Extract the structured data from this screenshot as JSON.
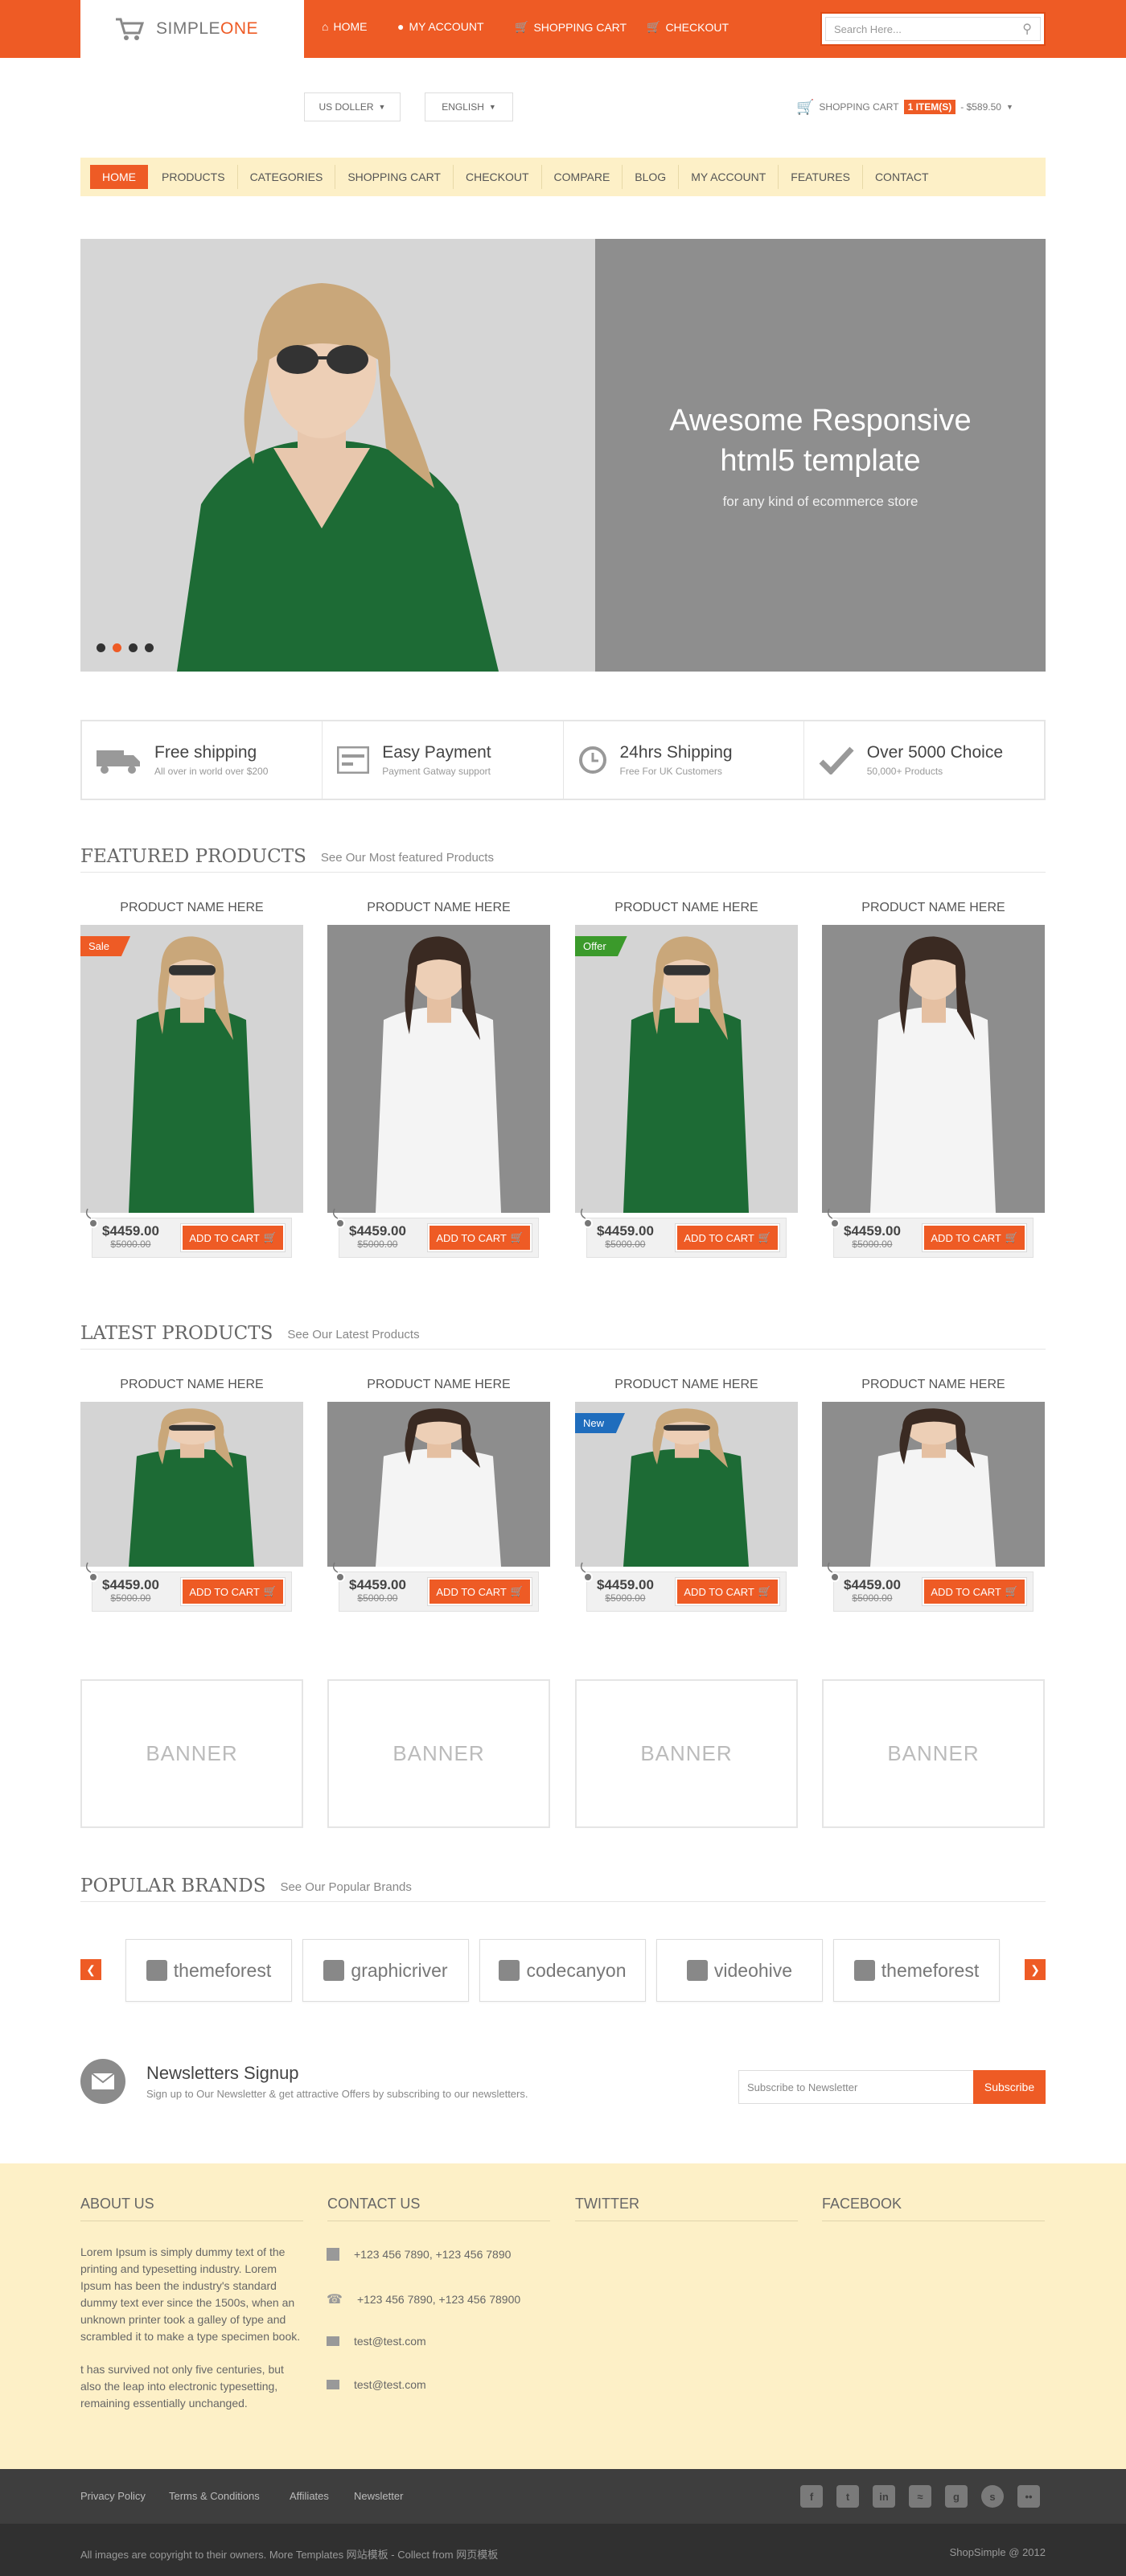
{
  "header": {
    "logo_part1": "SIMPLE",
    "logo_part2": "ONE",
    "links": [
      "HOME",
      "MY ACCOUNT",
      "SHOPPING CART",
      "CHECKOUT"
    ],
    "search_placeholder": "Search Here..."
  },
  "selectors": {
    "currency": "US DOLLER",
    "language": "ENGLISH"
  },
  "mini_cart": {
    "label": "SHOPPING CART",
    "count": "1 ITEM(S)",
    "total": "- $589.50"
  },
  "nav": [
    "HOME",
    "PRODUCTS",
    "CATEGORIES",
    "SHOPPING CART",
    "CHECKOUT",
    "COMPARE",
    "BLOG",
    "MY ACCOUNT",
    "FEATURES",
    "CONTACT"
  ],
  "hero": {
    "title": "Awesome Responsive html5 template",
    "subtitle": "for any kind of ecommerce store"
  },
  "features": [
    {
      "title": "Free shipping",
      "sub": "All over in world over $200",
      "icon": "truck-icon"
    },
    {
      "title": "Easy Payment",
      "sub": "Payment Gatway support",
      "icon": "card-icon"
    },
    {
      "title": "24hrs Shipping",
      "sub": "Free For UK Customers",
      "icon": "clock-icon"
    },
    {
      "title": "Over 5000 Choice",
      "sub": "50,000+ Products",
      "icon": "check-icon"
    }
  ],
  "featured": {
    "title": "FEATURED PRODUCTS",
    "sub": "See Our Most featured Products",
    "products": [
      {
        "name": "PRODUCT NAME HERE",
        "price": "$4459.00",
        "old": "$5000.00",
        "badge": "Sale",
        "cta": "ADD TO CART"
      },
      {
        "name": "PRODUCT NAME HERE",
        "price": "$4459.00",
        "old": "$5000.00",
        "badge": "",
        "cta": "ADD TO CART"
      },
      {
        "name": "PRODUCT NAME HERE",
        "price": "$4459.00",
        "old": "$5000.00",
        "badge": "Offer",
        "cta": "ADD TO CART"
      },
      {
        "name": "PRODUCT NAME HERE",
        "price": "$4459.00",
        "old": "$5000.00",
        "badge": "",
        "cta": "ADD TO CART"
      }
    ]
  },
  "latest": {
    "title": "LATEST PRODUCTS",
    "sub": "See Our Latest Products",
    "products": [
      {
        "name": "PRODUCT NAME HERE",
        "price": "$4459.00",
        "old": "$5000.00",
        "badge": "",
        "cta": "ADD TO CART"
      },
      {
        "name": "PRODUCT NAME HERE",
        "price": "$4459.00",
        "old": "$5000.00",
        "badge": "",
        "cta": "ADD TO CART"
      },
      {
        "name": "PRODUCT NAME HERE",
        "price": "$4459.00",
        "old": "$5000.00",
        "badge": "New",
        "cta": "ADD TO CART"
      },
      {
        "name": "PRODUCT NAME HERE",
        "price": "$4459.00",
        "old": "$5000.00",
        "badge": "",
        "cta": "ADD TO CART"
      }
    ]
  },
  "banners": [
    "BANNER",
    "BANNER",
    "BANNER",
    "BANNER"
  ],
  "brands": {
    "title": "POPULAR BRANDS",
    "sub": "See Our Popular Brands",
    "items": [
      "themeforest",
      "graphicriver",
      "codecanyon",
      "videohive",
      "themeforest"
    ]
  },
  "newsletter": {
    "title": "Newsletters Signup",
    "sub": "Sign up to Our Newsletter & get attractive Offers by subscribing to our newsletters.",
    "placeholder": "Subscribe to Newsletter",
    "button": "Subscribe"
  },
  "footer": {
    "about_title": "ABOUT US",
    "about_p1": "Lorem Ipsum is simply dummy text of the printing and typesetting industry. Lorem Ipsum has been the industry's standard dummy text ever since the 1500s, when an unknown printer took a galley of type and scrambled it to make a type specimen book.",
    "about_p2": "t has survived not only five centuries, but also the leap into electronic typesetting, remaining essentially unchanged.",
    "contact_title": "CONTACT US",
    "contacts": [
      "+123 456 7890, +123 456 7890",
      "+123 456 7890, +123 456 78900",
      "test@test.com",
      "test@test.com"
    ],
    "twitter_title": "TWITTER",
    "facebook_title": "FACEBOOK",
    "links": [
      "Privacy Policy",
      "Terms & Conditions",
      "Affiliates",
      "Newsletter"
    ],
    "copyright": "All images are copyright to their owners. More Templates 网站模板 - Collect from 网页模板",
    "credit": "ShopSimple @ 2012"
  },
  "colors": {
    "accent": "#ee5b25",
    "cream": "#fdf0c7",
    "sale": "#ee5b25",
    "offer": "#3b9a2b",
    "new": "#1f6dbd"
  }
}
